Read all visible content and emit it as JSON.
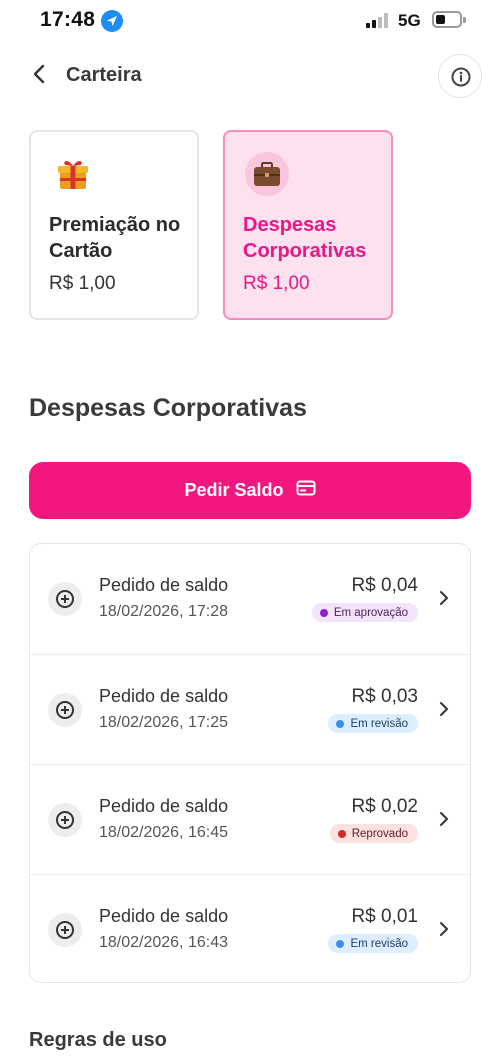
{
  "status_bar": {
    "time": "17:48",
    "network": "5G"
  },
  "header": {
    "title": "Carteira"
  },
  "wallets": [
    {
      "title": "Premiação no Cartão",
      "value": "R$ 1,00",
      "icon": "gift-icon",
      "selected": false
    },
    {
      "title": "Despesas Corporativas",
      "value": "R$ 1,00",
      "icon": "briefcase-icon",
      "selected": true
    }
  ],
  "section": {
    "title": "Despesas Corporativas"
  },
  "request_button": {
    "label": "Pedir Saldo"
  },
  "requests": [
    {
      "title": "Pedido de saldo",
      "date": "18/02/2026, 17:28",
      "amount": "R$ 0,04",
      "status": "Em aprovação",
      "status_bg": "#f3e3fb",
      "status_dot": "#8a1fd6",
      "status_text": "#4a2660"
    },
    {
      "title": "Pedido de saldo",
      "date": "18/02/2026, 17:25",
      "amount": "R$ 0,03",
      "status": "Em revisão",
      "status_bg": "#dceeff",
      "status_dot": "#3d8fe8",
      "status_text": "#1f3d66"
    },
    {
      "title": "Pedido de saldo",
      "date": "18/02/2026, 16:45",
      "amount": "R$ 0,02",
      "status": "Reprovado",
      "status_bg": "#fde0e0",
      "status_dot": "#d12a2a",
      "status_text": "#5a1f1f"
    },
    {
      "title": "Pedido de saldo",
      "date": "18/02/2026, 16:43",
      "amount": "R$ 0,01",
      "status": "Em revisão",
      "status_bg": "#dceeff",
      "status_dot": "#3d8fe8",
      "status_text": "#1f3d66"
    }
  ],
  "footer": {
    "title": "Regras de uso"
  },
  "colors": {
    "brand_pink": "#f2167f",
    "selected_card_bg": "#fde1ef",
    "selected_card_border": "#f58cbf"
  }
}
